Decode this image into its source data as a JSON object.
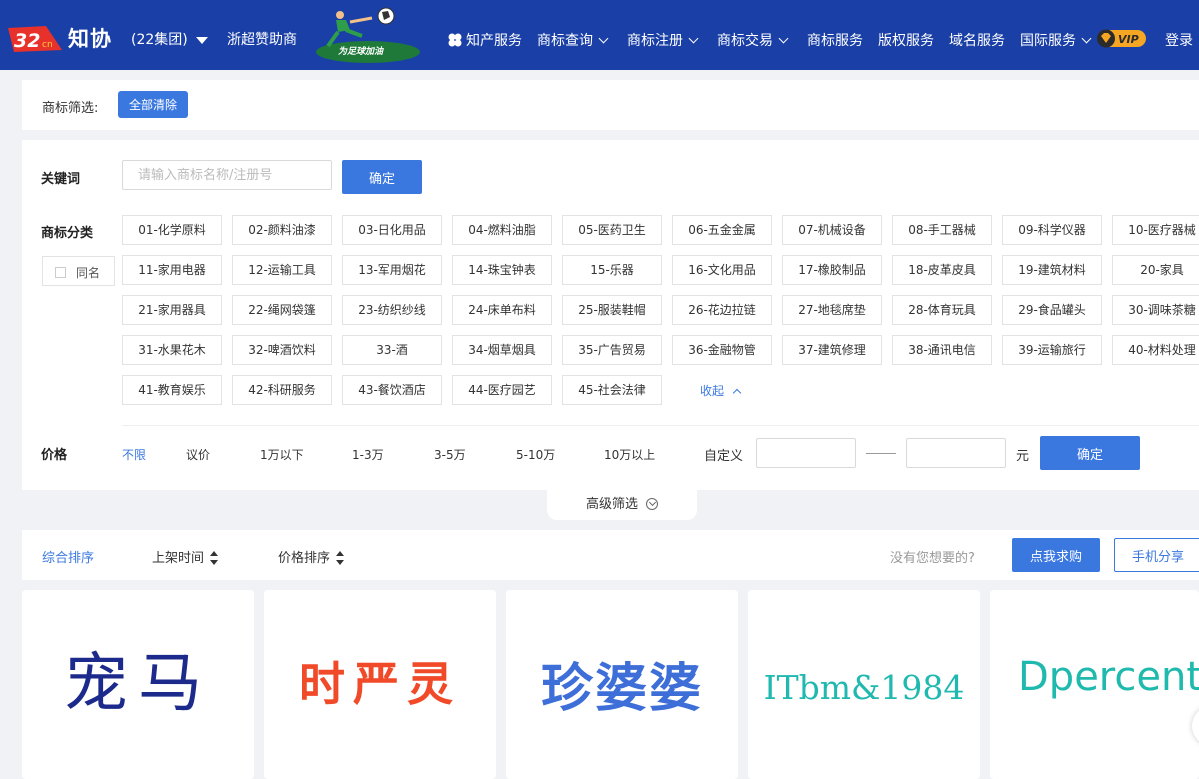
{
  "header": {
    "brand_text": "知协",
    "group": "(22集团)",
    "sponsor": "浙超赞助商",
    "banner_slogan": "为足球加油",
    "nav": [
      {
        "label": "知产服务",
        "dropdown": false
      },
      {
        "label": "商标查询",
        "dropdown": true
      },
      {
        "label": "商标注册",
        "dropdown": true
      },
      {
        "label": "商标交易",
        "dropdown": true
      },
      {
        "label": "商标服务",
        "dropdown": false
      },
      {
        "label": "版权服务",
        "dropdown": false
      },
      {
        "label": "域名服务",
        "dropdown": false
      },
      {
        "label": "国际服务",
        "dropdown": true
      }
    ],
    "vip_label": "VIP",
    "login": "登录",
    "bg_color": "#1a3fa6"
  },
  "filterbar": {
    "label": "商标筛选:",
    "clear_label": "全部清除"
  },
  "keyword": {
    "label": "关键词",
    "placeholder": "请输入商标名称/注册号",
    "value": "",
    "confirm": "确定"
  },
  "categories": {
    "label": "商标分类",
    "same_name": "同名",
    "items": [
      "01-化学原料",
      "02-颜料油漆",
      "03-日化用品",
      "04-燃料油脂",
      "05-医药卫生",
      "06-五金金属",
      "07-机械设备",
      "08-手工器械",
      "09-科学仪器",
      "10-医疗器械",
      "11-家用电器",
      "12-运输工具",
      "13-军用烟花",
      "14-珠宝钟表",
      "15-乐器",
      "16-文化用品",
      "17-橡胶制品",
      "18-皮革皮具",
      "19-建筑材料",
      "20-家具",
      "21-家用器具",
      "22-绳网袋篷",
      "23-纺织纱线",
      "24-床单布料",
      "25-服装鞋帽",
      "26-花边拉链",
      "27-地毯席垫",
      "28-体育玩具",
      "29-食品罐头",
      "30-调味茶糖",
      "31-水果花木",
      "32-啤酒饮料",
      "33-酒",
      "34-烟草烟具",
      "35-广告贸易",
      "36-金融物管",
      "37-建筑修理",
      "38-通讯电信",
      "39-运输旅行",
      "40-材料处理",
      "41-教育娱乐",
      "42-科研服务",
      "43-餐饮酒店",
      "44-医疗园艺",
      "45-社会法律"
    ],
    "collapse": "收起"
  },
  "price": {
    "label": "价格",
    "options": [
      "不限",
      "议价",
      "1万以下",
      "1-3万",
      "3-5万",
      "5-10万",
      "10万以上"
    ],
    "active": "不限",
    "custom_label": "自定义",
    "min_value": "",
    "max_value": "",
    "unit": "元",
    "confirm": "确定"
  },
  "advanced": {
    "label": "高级筛选"
  },
  "sort": {
    "items": [
      "综合排序",
      "上架时间",
      "价格排序"
    ],
    "active": "综合排序",
    "prompt": "没有您想要的?",
    "buy": "点我求购",
    "share": "手机分享"
  },
  "cards": [
    {
      "mark": "宠马"
    },
    {
      "mark": "时严灵"
    },
    {
      "mark": "珍婆婆"
    },
    {
      "mark": "ITbm&1984"
    },
    {
      "mark": "Dpercent"
    }
  ],
  "colors": {
    "accent": "#3a78e0",
    "header": "#1a3fa6"
  }
}
